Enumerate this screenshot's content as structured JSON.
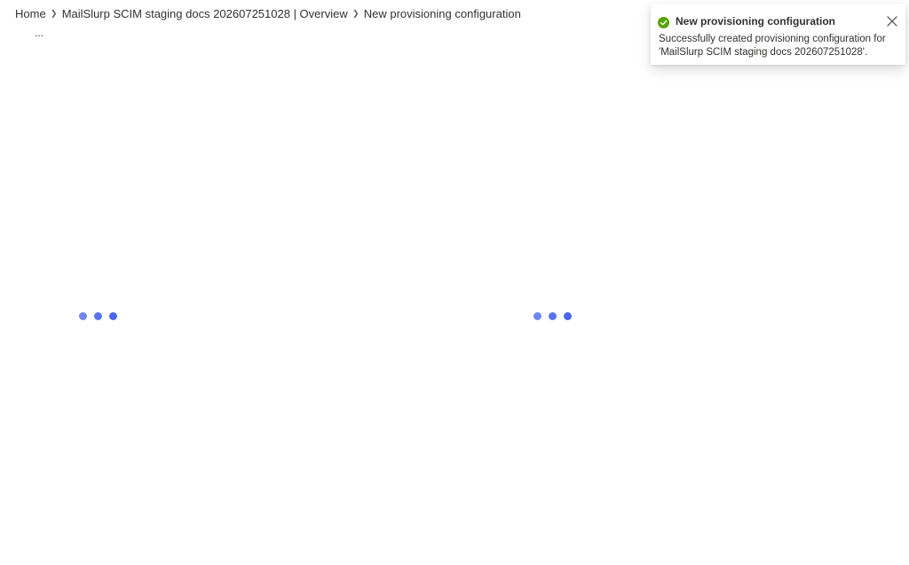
{
  "breadcrumb": {
    "items": [
      {
        "label": "Home"
      },
      {
        "label": "MailSlurp SCIM staging docs 202607251028 | Overview"
      },
      {
        "label": "New provisioning configuration"
      }
    ],
    "separator_icon": "chevron-right-icon"
  },
  "header": {
    "more_label": "..."
  },
  "loaders": {
    "icon": "loading-dots-icon",
    "color": "#4f6bed"
  },
  "notification": {
    "status_icon": "success-check-icon",
    "status_color": "#57a300",
    "title": "New provisioning configuration",
    "message": "Successfully created provisioning configuration for 'MailSlurp SCIM staging docs 202607251028'.",
    "close_icon": "close-icon"
  }
}
